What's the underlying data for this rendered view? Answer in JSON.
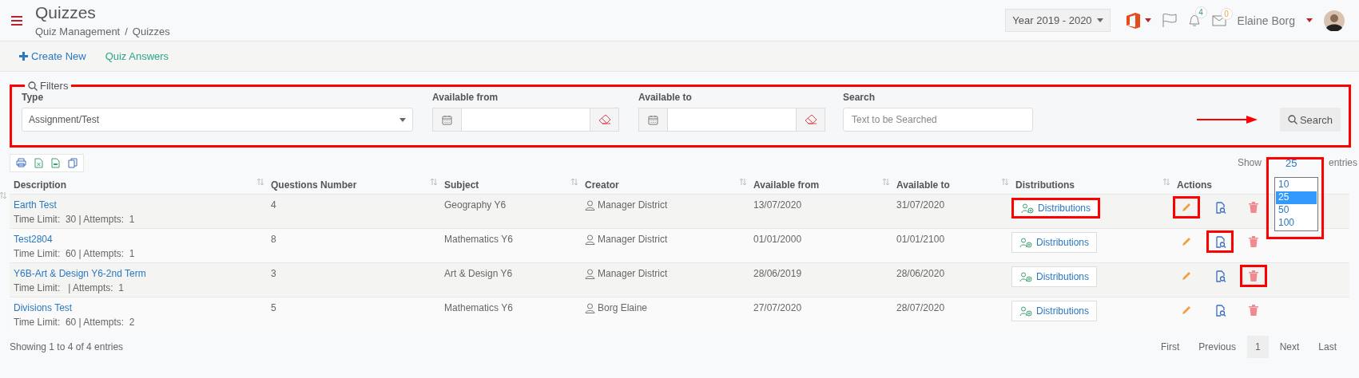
{
  "header": {
    "title": "Quizzes",
    "breadcrumb": [
      "Quiz Management",
      "Quizzes"
    ],
    "breadcrumb_separator": "/",
    "year": "Year 2019 - 2020",
    "notifications": "4",
    "messages": "0",
    "user": "Elaine Borg"
  },
  "actions": [
    {
      "kind": "create",
      "label": "Create New"
    },
    {
      "kind": "link",
      "label": "Quiz Answers"
    }
  ],
  "filters": {
    "legend": "Filters",
    "highlighted": true,
    "type_label": "Type",
    "type_value": "Assignment/Test",
    "from_label": "Available from",
    "to_label": "Available to",
    "search_label": "Search",
    "search_placeholder": "Text to be Searched",
    "button": "Search"
  },
  "length": {
    "show": "Show",
    "value": "25",
    "entries": "entries",
    "highlighted": true,
    "options": [
      {
        "label": "10",
        "selected": false
      },
      {
        "label": "25",
        "selected": true
      },
      {
        "label": "50",
        "selected": false
      },
      {
        "label": "100",
        "selected": false
      }
    ]
  },
  "table": {
    "columns": [
      "Description",
      "Questions Number",
      "Subject",
      "Creator",
      "Available from",
      "Available to",
      "Distributions",
      "Actions"
    ],
    "rows": [
      {
        "title": "Earth Test",
        "meta": "Time Limit:  30 | Attempts:  1",
        "questions": "4",
        "subject": "Geography Y6",
        "creator": "Manager District",
        "from": "13/07/2020",
        "to": "31/07/2020",
        "distributions": "Distributions",
        "distributions_highlighted": true,
        "edit_highlighted": true,
        "view_highlighted": false,
        "delete_highlighted": false
      },
      {
        "title": "Test2804",
        "meta": "Time Limit:  60 | Attempts:  1",
        "questions": "8",
        "subject": "Mathematics Y6",
        "creator": "Manager District",
        "from": "01/01/2000",
        "to": "01/01/2100",
        "distributions": "Distributions",
        "distributions_highlighted": false,
        "edit_highlighted": false,
        "view_highlighted": true,
        "delete_highlighted": false
      },
      {
        "title": "Y6B-Art & Design Y6-2nd Term",
        "meta": "Time Limit:   | Attempts:  1",
        "questions": "3",
        "subject": "Art & Design Y6",
        "creator": "Manager District",
        "from": "28/06/2019",
        "to": "28/06/2020",
        "distributions": "Distributions",
        "distributions_highlighted": false,
        "edit_highlighted": false,
        "view_highlighted": false,
        "delete_highlighted": true
      },
      {
        "title": "Divisions Test",
        "meta": "Time Limit:  60 | Attempts:  2",
        "questions": "5",
        "subject": "Mathematics Y6",
        "creator": "Borg Elaine",
        "from": "27/07/2020",
        "to": "28/07/2020",
        "distributions": "Distributions",
        "distributions_highlighted": false,
        "edit_highlighted": false,
        "view_highlighted": false,
        "delete_highlighted": false
      }
    ]
  },
  "info": "Showing 1 to 4 of 4 entries",
  "pagination": [
    {
      "label": "First",
      "selected": false
    },
    {
      "label": "Previous",
      "selected": false
    },
    {
      "label": "1",
      "selected": true
    },
    {
      "label": "Next",
      "selected": false
    },
    {
      "label": "Last",
      "selected": false
    }
  ]
}
